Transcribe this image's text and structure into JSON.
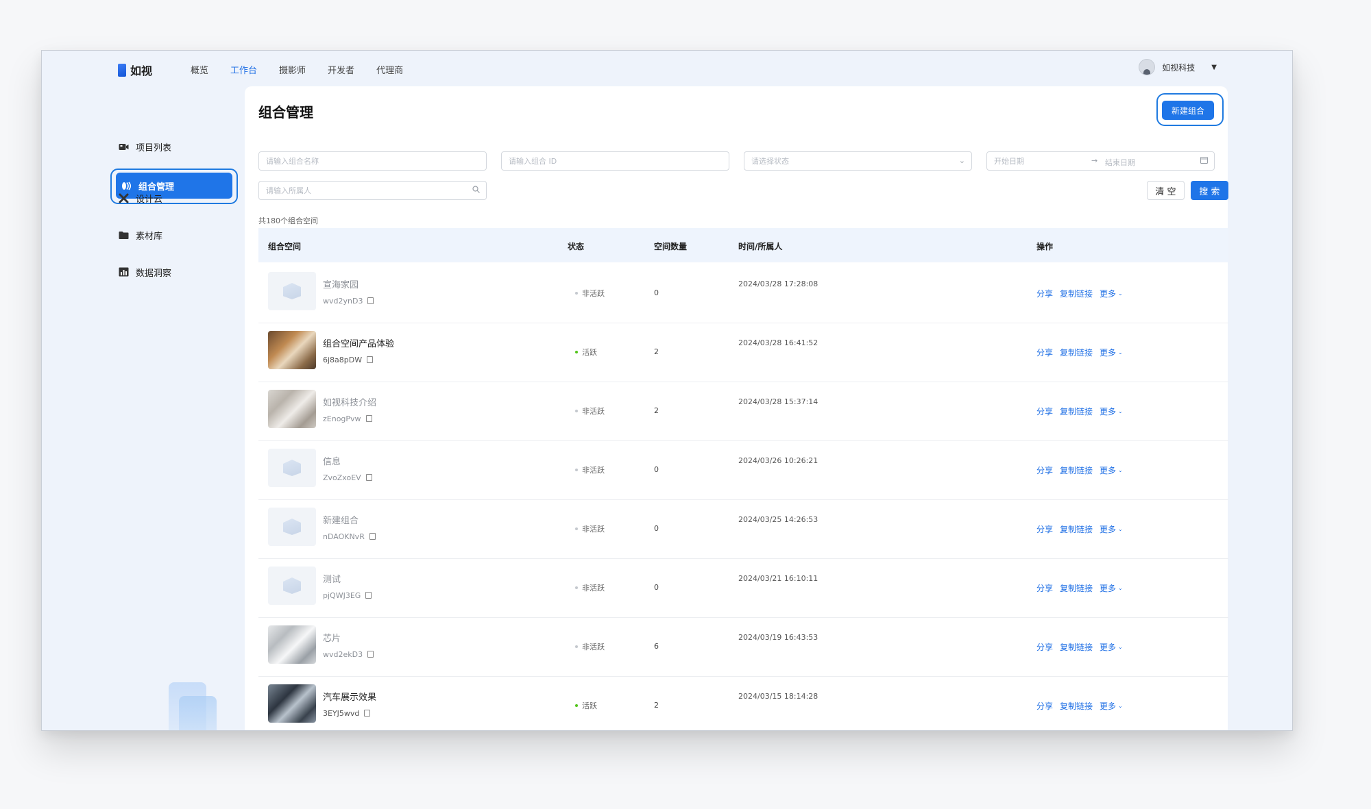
{
  "nav": {
    "logo": "如视",
    "items": [
      {
        "label": "概览",
        "active": false
      },
      {
        "label": "工作台",
        "active": true
      },
      {
        "label": "摄影师",
        "active": false
      },
      {
        "label": "开发者",
        "active": false
      },
      {
        "label": "代理商",
        "active": false
      }
    ],
    "user_name": "如视科技"
  },
  "sidebar": {
    "items": [
      {
        "label": "项目列表",
        "icon": "video-camera-icon",
        "active": false
      },
      {
        "label": "组合管理",
        "icon": "layers-icon",
        "active": true
      },
      {
        "label": "设计云",
        "icon": "design-tools-icon",
        "active": false
      },
      {
        "label": "素材库",
        "icon": "folder-icon",
        "active": false
      },
      {
        "label": "数据洞察",
        "icon": "chart-icon",
        "active": false
      }
    ],
    "bottom_icons": [
      "code-icon",
      "graduation-cap-icon",
      "cart-icon"
    ]
  },
  "page": {
    "title": "组合管理",
    "new_button": "新建组合"
  },
  "filters": {
    "name_placeholder": "请输入组合名称",
    "id_placeholder": "请输入组合 ID",
    "status_placeholder": "请选择状态",
    "start_date_placeholder": "开始日期",
    "end_date_placeholder": "结束日期",
    "owner_placeholder": "请输入所属人",
    "clear_button": "清 空",
    "search_button": "搜 索"
  },
  "total_text": "共180个组合空间",
  "table": {
    "headers": [
      "组合空间",
      "状态",
      "空间数量",
      "时间/所属人",
      "操作"
    ],
    "rows": [
      {
        "name": "宣海家园",
        "id": "wvd2ynD3",
        "status": "非活跃",
        "active": false,
        "count": "0",
        "time": "2024/03/28 17:28:08",
        "thumb": "empty"
      },
      {
        "name": "组合空间产品体验",
        "id": "6j8a8pDW",
        "status": "活跃",
        "active": true,
        "count": "2",
        "time": "2024/03/28 16:41:52",
        "thumb": "p1"
      },
      {
        "name": "如视科技介绍",
        "id": "zEnogPvw",
        "status": "非活跃",
        "active": false,
        "count": "2",
        "time": "2024/03/28 15:37:14",
        "thumb": "p2"
      },
      {
        "name": "信息",
        "id": "ZvoZxoEV",
        "status": "非活跃",
        "active": false,
        "count": "0",
        "time": "2024/03/26 10:26:21",
        "thumb": "empty"
      },
      {
        "name": "新建组合",
        "id": "nDAOKNvR",
        "status": "非活跃",
        "active": false,
        "count": "0",
        "time": "2024/03/25 14:26:53",
        "thumb": "empty"
      },
      {
        "name": "测试",
        "id": "pjQWJ3EG",
        "status": "非活跃",
        "active": false,
        "count": "0",
        "time": "2024/03/21 16:10:11",
        "thumb": "empty"
      },
      {
        "name": "芯片",
        "id": "wvd2ekD3",
        "status": "非活跃",
        "active": false,
        "count": "6",
        "time": "2024/03/19 16:43:53",
        "thumb": "p3"
      },
      {
        "name": "汽车展示效果",
        "id": "3EYJ5wvd",
        "status": "活跃",
        "active": true,
        "count": "2",
        "time": "2024/03/15 18:14:28",
        "thumb": "p4"
      }
    ],
    "actions": {
      "share": "分享",
      "copy_link": "复制链接",
      "more": "更多"
    }
  },
  "colors": {
    "accent": "#1f75e8",
    "active_dot": "#52c41a"
  }
}
